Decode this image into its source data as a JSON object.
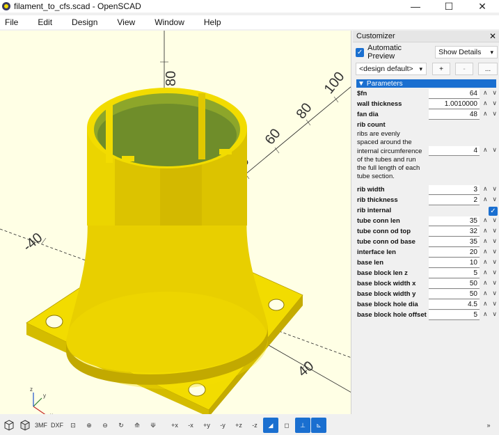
{
  "window": {
    "title": "filament_to_cfs.scad - OpenSCAD",
    "minimize": "—",
    "maximize": "☐",
    "close": "✕"
  },
  "menu": [
    "File",
    "Edit",
    "Design",
    "View",
    "Window",
    "Help"
  ],
  "viewport": {
    "axis_labels": [
      "100",
      "80",
      "60",
      "40",
      "80",
      "60",
      "40",
      "-40",
      "40"
    ],
    "gizmo": {
      "x": "x",
      "y": "y",
      "z": "z"
    },
    "colors": {
      "background": "#ffffe5",
      "model": "#f2dc00",
      "model_dark": "#c9b000",
      "model_side": "#e0c800"
    }
  },
  "toolbar": {
    "items": [
      "preview",
      "render",
      "export-3mf",
      "export-dxf",
      "zoom-all",
      "zoom-in",
      "zoom-out",
      "reset-view",
      "view-perspective",
      "view-orthogonal",
      "view-right",
      "view-top",
      "view-bottom",
      "view-left",
      "view-front",
      "view-back",
      "axes-toggle",
      "edges-toggle",
      "crosshairs-toggle",
      "scale-markers-toggle"
    ],
    "label_3mf": "3MF",
    "label_dxf": "DXF",
    "more": "»"
  },
  "customizer": {
    "title": "Customizer",
    "auto_preview": "Automatic Preview",
    "details_select": "Show Details",
    "preset_select": "<design default>",
    "add_btn": "+",
    "remove_btn": "-",
    "more_btn": "...",
    "section": "Parameters",
    "params": [
      {
        "label": "$fn",
        "value": "64"
      },
      {
        "label": "wall thickness",
        "value": "1.0010000"
      },
      {
        "label": "fan dia",
        "value": "48"
      },
      {
        "label": "rib count",
        "value": "4",
        "description": "ribs are evenly spaced around the internal circumference of the tubes and run the full length of each tube section."
      },
      {
        "label": "rib width",
        "value": "3"
      },
      {
        "label": "rib thickness",
        "value": "2"
      },
      {
        "label": "rib internal",
        "value": "",
        "checkbox": true
      },
      {
        "label": "tube conn len",
        "value": "35"
      },
      {
        "label": "tube conn od top",
        "value": "32"
      },
      {
        "label": "tube conn od base",
        "value": "35"
      },
      {
        "label": "interface len",
        "value": "20"
      },
      {
        "label": "base len",
        "value": "10"
      },
      {
        "label": "base block len z",
        "value": "5"
      },
      {
        "label": "base block width x",
        "value": "50"
      },
      {
        "label": "base block width y",
        "value": "50"
      },
      {
        "label": "base block hole dia",
        "value": "4.5"
      },
      {
        "label": "base block hole offset f",
        "value": "5"
      }
    ]
  }
}
